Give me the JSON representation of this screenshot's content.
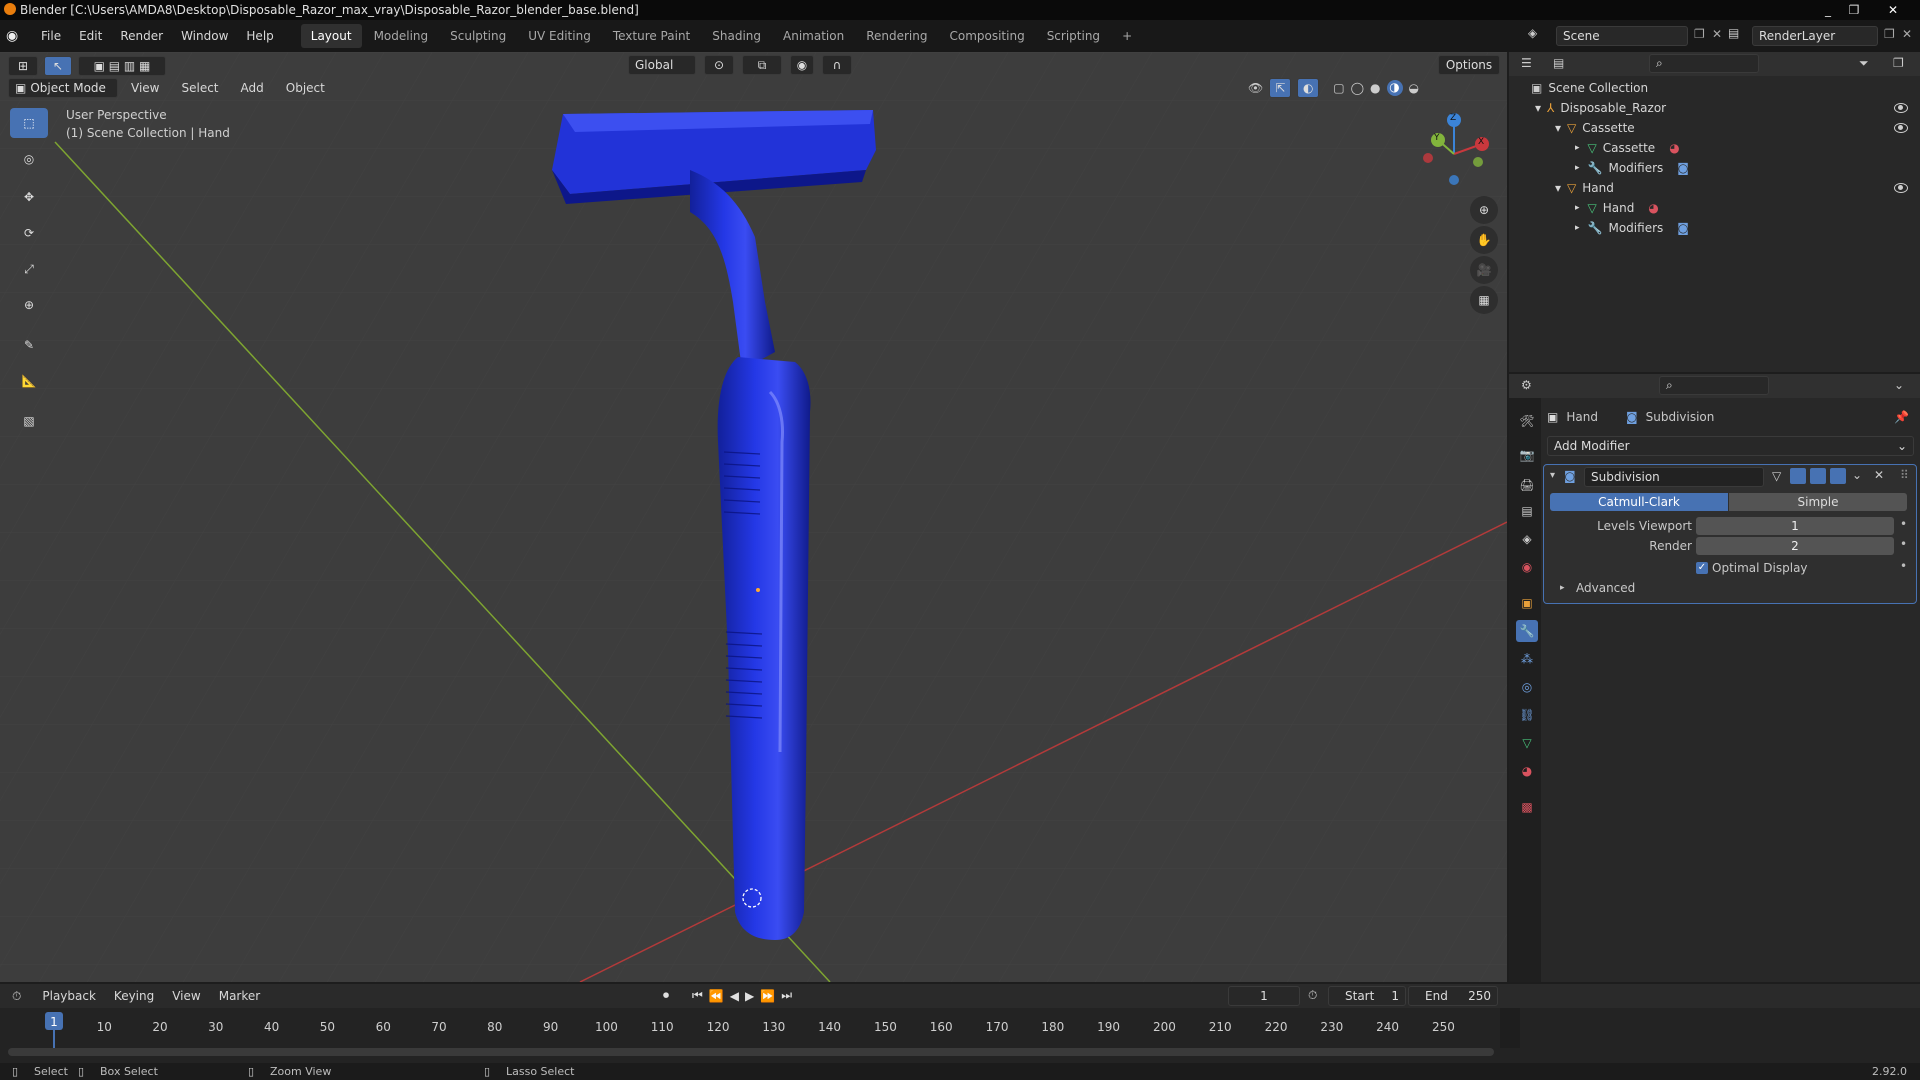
{
  "window": {
    "title": "Blender [C:\\Users\\AMDA8\\Desktop\\Disposable_Razor_max_vray\\Disposable_Razor_blender_base.blend]",
    "minimize": "_",
    "restore": "❐",
    "close": "✕"
  },
  "menu": [
    "File",
    "Edit",
    "Render",
    "Window",
    "Help"
  ],
  "workspaces": [
    "Layout",
    "Modeling",
    "Sculpting",
    "UV Editing",
    "Texture Paint",
    "Shading",
    "Animation",
    "Rendering",
    "Compositing",
    "Scripting",
    "+"
  ],
  "scene": {
    "name": "Scene",
    "render_layer": "RenderLayer"
  },
  "viewport_header": {
    "transform_orientation": "Global",
    "options": "Options",
    "mode": "Object Mode",
    "menus": [
      "View",
      "Select",
      "Add",
      "Object"
    ]
  },
  "viewport": {
    "perspective_label": "User Perspective",
    "collection_label": "(1) Scene Collection | Hand",
    "gizmo_axes": {
      "x": "X",
      "y": "Y",
      "z": "Z"
    }
  },
  "outliner": {
    "root": "Scene Collection",
    "items": [
      {
        "label": "Disposable_Razor",
        "level": 0
      },
      {
        "label": "Cassette",
        "level": 1
      },
      {
        "label": "Cassette",
        "level": 2
      },
      {
        "label": "Modifiers",
        "level": 2
      },
      {
        "label": "Hand",
        "level": 1
      },
      {
        "label": "Hand",
        "level": 2
      },
      {
        "label": "Modifiers",
        "level": 2
      }
    ]
  },
  "properties": {
    "object_name": "Hand",
    "modifier_breadcrumb": "Subdivision",
    "add_modifier": "Add Modifier",
    "modifier": {
      "name": "Subdivision",
      "type_options": [
        "Catmull-Clark",
        "Simple"
      ],
      "selected_type": "Catmull-Clark",
      "levels_viewport_label": "Levels Viewport",
      "levels_viewport": "1",
      "render_label": "Render",
      "render": "2",
      "optimal_display_label": "Optimal Display",
      "optimal_display": true,
      "advanced_label": "Advanced"
    }
  },
  "timeline": {
    "menus": [
      "Playback",
      "Keying",
      "View",
      "Marker"
    ],
    "current_frame": "1",
    "start_label": "Start",
    "start": "1",
    "end_label": "End",
    "end": "250",
    "ticks": [
      "1",
      "10",
      "20",
      "30",
      "40",
      "50",
      "60",
      "70",
      "80",
      "90",
      "100",
      "110",
      "120",
      "130",
      "140",
      "150",
      "160",
      "170",
      "180",
      "190",
      "200",
      "210",
      "220",
      "230",
      "240",
      "250"
    ]
  },
  "statusbar": {
    "select": "Select",
    "box_select": "Box Select",
    "zoom_view": "Zoom View",
    "lasso_select": "Lasso Select",
    "version": "2.92.0"
  },
  "colors": {
    "accent": "#4772b3",
    "razor": "#1e2fd6",
    "x_axis": "#c8383d",
    "y_axis": "#82b43c",
    "z_axis": "#3b84d8"
  }
}
